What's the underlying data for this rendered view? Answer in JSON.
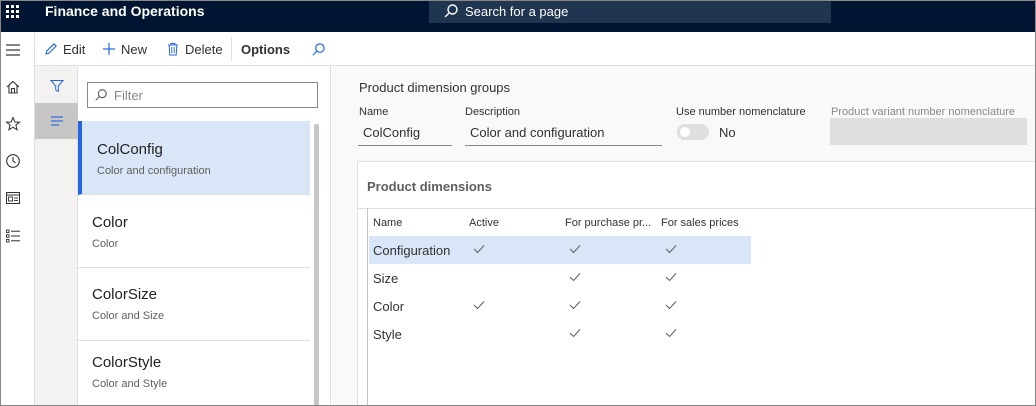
{
  "app": {
    "title": "Finance and Operations",
    "search_label": "Search for a page"
  },
  "nav_rail": {
    "icons": [
      "hamburger-icon",
      "home-icon",
      "star-icon",
      "clock-icon",
      "workspace-icon",
      "list-icon"
    ]
  },
  "actions": {
    "edit": "Edit",
    "new": "New",
    "delete": "Delete",
    "options": "Options"
  },
  "list_pane": {
    "filter_placeholder": "Filter",
    "items": [
      {
        "title": "ColConfig",
        "subtitle": "Color and configuration",
        "selected": true
      },
      {
        "title": "Color",
        "subtitle": "Color",
        "selected": false
      },
      {
        "title": "ColorSize",
        "subtitle": "Color and Size",
        "selected": false
      },
      {
        "title": "ColorStyle",
        "subtitle": "Color and Style",
        "selected": false
      }
    ]
  },
  "detail": {
    "page_title": "Product dimension groups",
    "name_label": "Name",
    "name_value": "ColConfig",
    "description_label": "Description",
    "description_value": "Color and configuration",
    "use_number_label": "Use number nomenclature",
    "use_number_value": "No",
    "variant_label": "Product variant number nomenclature"
  },
  "dimensions": {
    "title": "Product dimensions",
    "columns": [
      "Name",
      "Active",
      "For purchase pr...",
      "For sales prices"
    ],
    "rows": [
      {
        "name": "Configuration",
        "active": true,
        "purchase": true,
        "sales": true,
        "selected": true
      },
      {
        "name": "Size",
        "active": false,
        "purchase": true,
        "sales": true,
        "selected": false
      },
      {
        "name": "Color",
        "active": true,
        "purchase": true,
        "sales": true,
        "selected": false
      },
      {
        "name": "Style",
        "active": false,
        "purchase": true,
        "sales": true,
        "selected": false
      }
    ]
  },
  "colors": {
    "topbar": "#001532",
    "accent": "#2266e3",
    "selection": "#d9e6f8"
  }
}
